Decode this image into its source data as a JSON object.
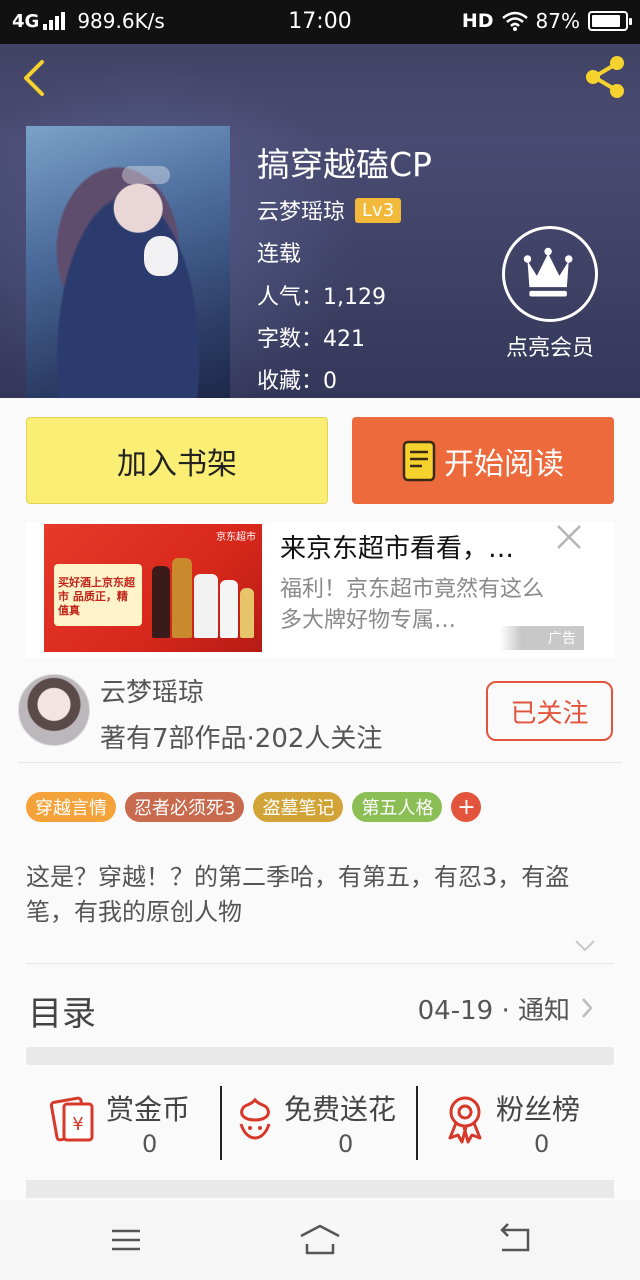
{
  "status_bar": {
    "network": "4G",
    "speed": "989.6K/s",
    "time": "17:00",
    "hd": "HD",
    "battery": "87%",
    "battery_level": 0.87
  },
  "book": {
    "title": "搞穿越磕CP",
    "author": "云梦瑶琼",
    "level": "Lv3",
    "status": "连载",
    "popularity": "人气：1,129",
    "word_count": "字数：421",
    "favorites": "收藏：0"
  },
  "vip": {
    "label": "点亮会员"
  },
  "actions": {
    "shelf_label": "加入书架",
    "read_label": "开始阅读"
  },
  "ad": {
    "title": "来京东超市看看，…",
    "description": "福利！京东超市竟然有这么多大牌好物专属…",
    "tag": "广告",
    "image_text": "买好酒上京东超市 品质正，精值真",
    "image_brand": "京东超市"
  },
  "author": {
    "name": "云梦瑶琼",
    "meta": "著有7部作品·202人关注",
    "follow_label": "已关注"
  },
  "tags": [
    {
      "label": "穿越言情",
      "color": "#f4a23a"
    },
    {
      "label": "忍者必须死3",
      "color": "#c86a4e"
    },
    {
      "label": "盗墓笔记",
      "color": "#d2a437"
    },
    {
      "label": "第五人格",
      "color": "#8bbf55"
    }
  ],
  "tag_add": "+",
  "description": "这是？穿越！？的第二季哈，有第五，有忍3，有盗笔，有我的原创人物",
  "catalog": {
    "label": "目录",
    "info": "04-19 · 通知"
  },
  "stats": [
    {
      "label": "赏金币",
      "value": "0",
      "icon": "red-envelope-icon"
    },
    {
      "label": "免费送花",
      "value": "0",
      "icon": "flower-icon"
    },
    {
      "label": "粉丝榜",
      "value": "0",
      "icon": "medal-icon"
    }
  ],
  "colors": {
    "accent_orange": "#ec6a3c",
    "shelf_yellow": "#fbee74",
    "follow_red": "#e2553c",
    "icon_red": "#d6382a",
    "level_badge": "#f2b93b"
  }
}
